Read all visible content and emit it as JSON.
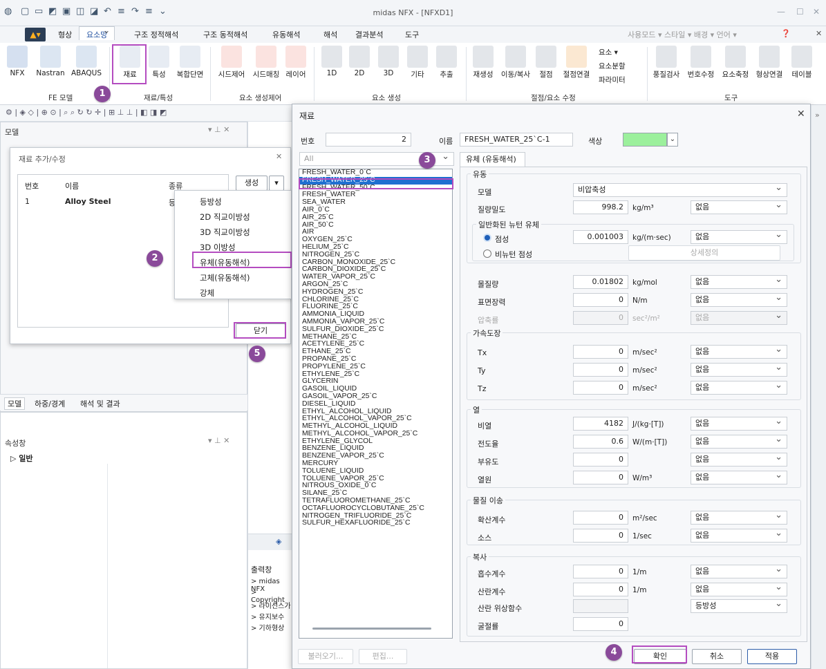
{
  "window": {
    "title": "midas NFX - [NFXD1]"
  },
  "menu": {
    "items": [
      "형상",
      "요소망",
      "구조 정적해석",
      "구조 동적해석",
      "유동해석",
      "해석",
      "결과분석",
      "도구"
    ],
    "right": "사용모드 ▾ 스타일 ▾ 배경 ▾ 언어 ▾"
  },
  "ribbon": {
    "buttons": [
      "NFX",
      "Nastran",
      "ABAQUS",
      "재료",
      "특성",
      "복합단면",
      "시드제어",
      "시드매칭",
      "레이어",
      "1D",
      "2D",
      "3D",
      "기타",
      "추출",
      "재생성",
      "이동/복사",
      "절점",
      "절점연결",
      "풍질검사",
      "번호수정",
      "요소축정",
      "형상연결",
      "테이블"
    ],
    "small": [
      "요소 ▾",
      "요소분할",
      "파라미터"
    ],
    "groups": [
      "FE 모델",
      "재료/특성",
      "요소 생성제어",
      "요소 생성",
      "절점/요소 수정",
      "도구"
    ]
  },
  "left": {
    "model_title": "모델",
    "tabs": [
      "모델",
      "하중/경계",
      "해석 및 결과"
    ],
    "props_title": "속성창",
    "props_item": "▷ 일반"
  },
  "matdlg": {
    "title": "재료 추가/수정",
    "cols": [
      "번호",
      "이름",
      "종류"
    ],
    "row": {
      "no": "1",
      "name": "Alloy Steel",
      "type": "등"
    },
    "create": "생성",
    "close": "닫기"
  },
  "ctxmenu": [
    "등방성",
    "2D 직교이방성",
    "3D 직교이방성",
    "3D 이방성",
    "유체(유동해석)",
    "고체(유동해석)",
    "강체"
  ],
  "output": {
    "title": "출력창",
    "lines": [
      "> midas NFX",
      "> Copyright",
      "> 라이선스가",
      "> 유지보수",
      "> 기하형상"
    ]
  },
  "dialog": {
    "title": "재료",
    "no_label": "번호",
    "no_value": "2",
    "name_label": "이름",
    "name_value": "FRESH_WATER_25`C-1",
    "color_label": "색상",
    "filter": "All",
    "tab": "유체 (유동해석)",
    "colors": {
      "swatch": "#9cf09c",
      "accent": "#b44cc0"
    },
    "materials": [
      "FRESH_WATER_0`C",
      "FRESH_WATER_25`C",
      "FRESH_WATER_50`C",
      "FRESH_WATER",
      "SEA_WATER",
      "AIR_0`C",
      "AIR_25`C",
      "AIR_50`C",
      "AIR",
      "OXYGEN_25`C",
      "HELIUM_25`C",
      "NITROGEN_25`C",
      "CARBON_MONOXIDE_25`C",
      "CARBON_DIOXIDE_25`C",
      "WATER_VAPOR_25`C",
      "ARGON_25`C",
      "HYDROGEN_25`C",
      "CHLORINE_25`C",
      "FLUORINE_25`C",
      "AMMONIA_LIQUID",
      "AMMONIA_VAPOR_25`C",
      "SULFUR_DIOXIDE_25`C",
      "METHANE_25`C",
      "ACETYLENE_25`C",
      "ETHANE_25`C",
      "PROPANE_25`C",
      "PROPYLENE_25`C",
      "ETHYLENE_25`C",
      "GLYCERIN",
      "GASOIL_LIQUID",
      "GASOIL_VAPOR_25`C",
      "DIESEL_LIQUID",
      "ETHYL_ALCOHOL_LIQUID",
      "ETHYL_ALCOHOL_VAPOR_25`C",
      "METHYL_ALCOHOL_LIQUID",
      "METHYL_ALCOHOL_VAPOR_25`C",
      "ETHYLENE_GLYCOL",
      "BENZENE_LIQUID",
      "BENZENE_VAPOR_25`C",
      "MERCURY",
      "TOLUENE_LIQUID",
      "TOLUENE_VAPOR_25`C",
      "NITROUS_OXIDE_0`C",
      "SILANE_25`C",
      "TETRAFLUOROMETHANE_25`C",
      "OCTAFLUOROCYCLOBUTANE_25`C",
      "NITROGEN_TRIFLUORIDE_25`C",
      "SULFUR_HEXAFLUORIDE_25`C"
    ],
    "selected_index": 1,
    "flow": "유동",
    "model_label": "모델",
    "model_value": "비압축성",
    "density": {
      "label": "질량밀도",
      "value": "998.2",
      "unit": "kg/m³",
      "fn": "없음"
    },
    "newton": "일반화된 뉴턴 유체",
    "visc": {
      "label": "점성",
      "value": "0.001003",
      "unit": "kg/(m·sec)",
      "fn": "없음"
    },
    "nonnewton": "비뉴턴 점성",
    "detail": "상세정의",
    "molar": {
      "label": "몰질량",
      "value": "0.01802",
      "unit": "kg/mol",
      "fn": "없음"
    },
    "surf": {
      "label": "표면장력",
      "value": "0",
      "unit": "N/m",
      "fn": "없음"
    },
    "comp": {
      "label": "압축률",
      "value": "0",
      "unit": "sec²/m²",
      "fn": "없음"
    },
    "accel": "가속도장",
    "tx": {
      "label": "Tx",
      "value": "0",
      "unit": "m/sec²",
      "fn": "없음"
    },
    "ty": {
      "label": "Ty",
      "value": "0",
      "unit": "m/sec²",
      "fn": "없음"
    },
    "tz": {
      "label": "Tz",
      "value": "0",
      "unit": "m/sec²",
      "fn": "없음"
    },
    "heat": "열",
    "cp": {
      "label": "비열",
      "value": "4182",
      "unit": "J/(kg·[T])",
      "fn": "없음"
    },
    "k": {
      "label": "전도율",
      "value": "0.6",
      "unit": "W/(m·[T])",
      "fn": "없음"
    },
    "buoy": {
      "label": "부유도",
      "value": "0",
      "unit": "",
      "fn": "없음"
    },
    "src": {
      "label": "열원",
      "value": "0",
      "unit": "W/m³",
      "fn": "없음"
    },
    "mass": "물질 이송",
    "diff": {
      "label": "확산계수",
      "value": "0",
      "unit": "m²/sec",
      "fn": "없음"
    },
    "msrc": {
      "label": "소스",
      "value": "0",
      "unit": "1/sec",
      "fn": "없음"
    },
    "rad": "복사",
    "abs": {
      "label": "흡수계수",
      "value": "0",
      "unit": "1/m",
      "fn": "없음"
    },
    "scat": {
      "label": "산란계수",
      "value": "0",
      "unit": "1/m",
      "fn": "없음"
    },
    "phase": {
      "label": "산란 위상함수",
      "fn": "등방성"
    },
    "refr": {
      "label": "굴절률",
      "value": "0"
    },
    "btns": {
      "load": "불러오기...",
      "edit": "편집...",
      "ok": "확인",
      "cancel": "취소",
      "apply": "적용"
    }
  },
  "badges": [
    "1",
    "2",
    "3",
    "4",
    "5"
  ]
}
